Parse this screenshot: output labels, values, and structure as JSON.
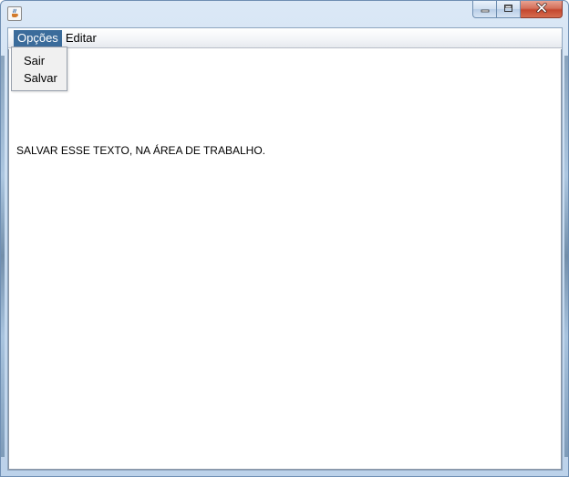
{
  "window": {
    "title": "",
    "icon": "java-cup-icon",
    "controls": {
      "minimize": "minimize-icon",
      "maximize": "maximize-icon",
      "close": "close-icon"
    }
  },
  "menubar": {
    "items": [
      {
        "label": "Opções",
        "selected": true
      },
      {
        "label": "Editar",
        "selected": false
      }
    ]
  },
  "popup_menu": {
    "items": [
      {
        "label": "Sair"
      },
      {
        "label": "Salvar"
      }
    ]
  },
  "content": {
    "text": "SALVAR ESSE TEXTO, NA ÁREA DE TRABALHO."
  },
  "colors": {
    "menu_selected_bg": "#3b6c9b",
    "close_button": "#c4472f"
  }
}
